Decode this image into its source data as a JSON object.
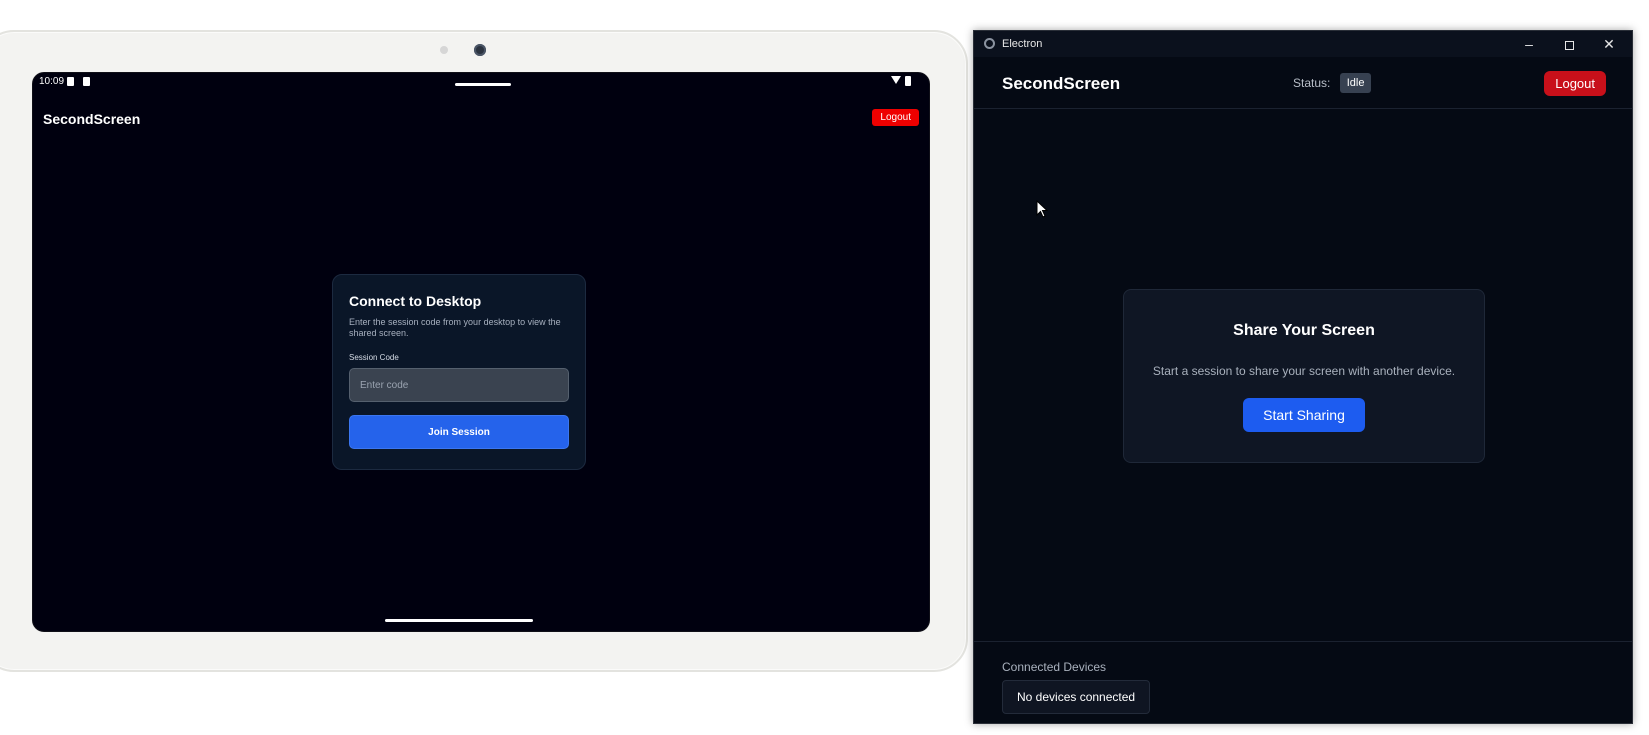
{
  "tablet": {
    "status_bar": {
      "time": "10:09"
    },
    "header": {
      "title": "SecondScreen",
      "logout_label": "Logout"
    },
    "card": {
      "title": "Connect to Desktop",
      "description": "Enter the session code from your desktop to view the shared screen.",
      "field_label": "Session Code",
      "input_placeholder": "Enter code",
      "input_value": "",
      "join_label": "Join Session"
    }
  },
  "window": {
    "title": "Electron",
    "controls": {
      "minimize": "–",
      "close": "✕"
    },
    "header": {
      "title": "SecondScreen",
      "status_label": "Status:",
      "status_value": "Idle",
      "logout_label": "Logout"
    },
    "share_card": {
      "title": "Share Your Screen",
      "description": "Start a session to share your screen with another device.",
      "start_label": "Start Sharing"
    },
    "devices": {
      "title": "Connected Devices",
      "empty_message": "No devices connected"
    }
  },
  "colors": {
    "accent_blue": "#1d5cf0",
    "logout_red": "#c8101a",
    "tablet_logout_red": "#ee0000",
    "status_badge": "#374151"
  },
  "icons": [
    "app-icon",
    "minimize-icon",
    "maximize-icon",
    "close-icon",
    "cursor-icon",
    "wifi-icon",
    "battery-icon",
    "sim-icon"
  ]
}
